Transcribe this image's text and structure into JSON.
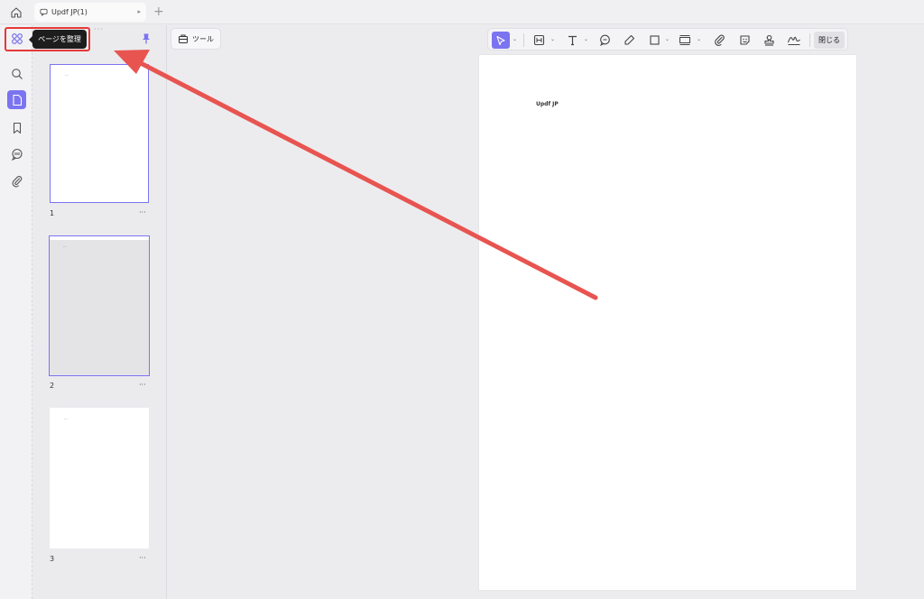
{
  "tabs": [
    {
      "label": "Updf JP(1)"
    }
  ],
  "left_rail": {
    "items": [
      "organize-pages-icon",
      "search-icon",
      "pages-icon",
      "bookmark-icon",
      "comment-icon",
      "attachment-icon"
    ],
    "tooltip": "ページを整理"
  },
  "tool_button": {
    "label": "ツール"
  },
  "toolbar": {
    "items": [
      "select-icon",
      "text-box-icon",
      "text-icon",
      "note-icon",
      "highlight-icon",
      "shape-icon",
      "measure-icon",
      "attachment-icon",
      "sticker-icon",
      "stamp-icon",
      "signature-icon"
    ],
    "close_label": "閉じる"
  },
  "thumbnails": [
    {
      "number": "1",
      "text": "...",
      "selected": true
    },
    {
      "number": "2",
      "text": "...",
      "selected": false
    },
    {
      "number": "3",
      "text": "...",
      "selected": false
    }
  ],
  "more_label": "···",
  "page": {
    "text": "Updf JP"
  },
  "colors": {
    "accent": "#7b74f0",
    "annotation": "#e53935"
  }
}
